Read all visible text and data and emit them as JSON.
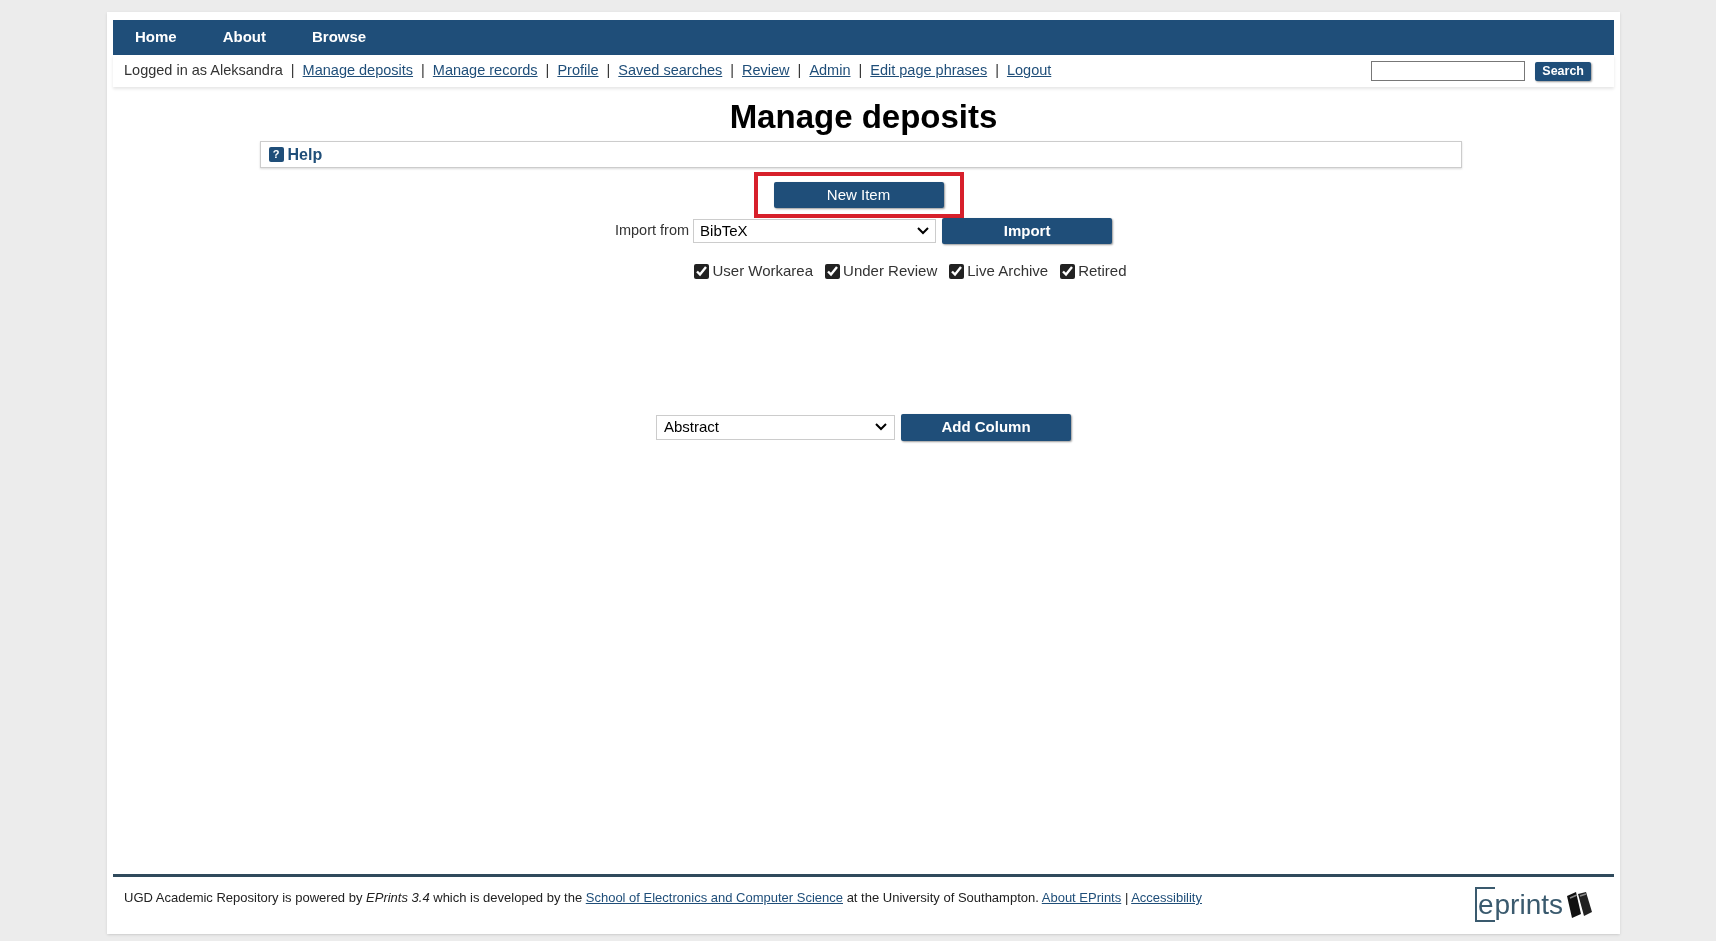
{
  "top_menu": [
    {
      "label": "Home"
    },
    {
      "label": "About"
    },
    {
      "label": "Browse"
    }
  ],
  "user_bar": {
    "logged_in": "Logged in as Aleksandra",
    "separator": "|",
    "links": [
      {
        "label": "Manage deposits"
      },
      {
        "label": "Manage records"
      },
      {
        "label": "Profile"
      },
      {
        "label": "Saved searches"
      },
      {
        "label": "Review"
      },
      {
        "label": "Admin"
      },
      {
        "label": "Edit page phrases"
      },
      {
        "label": "Logout"
      }
    ]
  },
  "search_button": "Search",
  "title": "Manage deposits",
  "help": {
    "label": "Help",
    "icon": "?"
  },
  "new_item": {
    "label": "New Item",
    "highlighted": true
  },
  "import": {
    "label": "Import from",
    "value": "BibTeX",
    "button": "Import"
  },
  "filters": [
    {
      "label": "User Workarea",
      "checked": true
    },
    {
      "label": "Under Review",
      "checked": true
    },
    {
      "label": "Live Archive",
      "checked": true
    },
    {
      "label": "Retired",
      "checked": true
    }
  ],
  "column_select": {
    "value": "Abstract",
    "button": "Add Column"
  },
  "footer": {
    "parts": [
      {
        "kind": "text",
        "text": "UGD Academic Repository is powered by *EPrints 3.4* which is developed by the"
      },
      {
        "kind": "link",
        "text": "School of Electronics and Computer Science"
      },
      {
        "kind": "text",
        "text": "at the University of Southampton."
      },
      {
        "kind": "link",
        "text": "About EPrints"
      },
      {
        "kind": "text",
        "text": "|"
      },
      {
        "kind": "link",
        "text": "Accessibility"
      }
    ],
    "logo": "eprints"
  }
}
